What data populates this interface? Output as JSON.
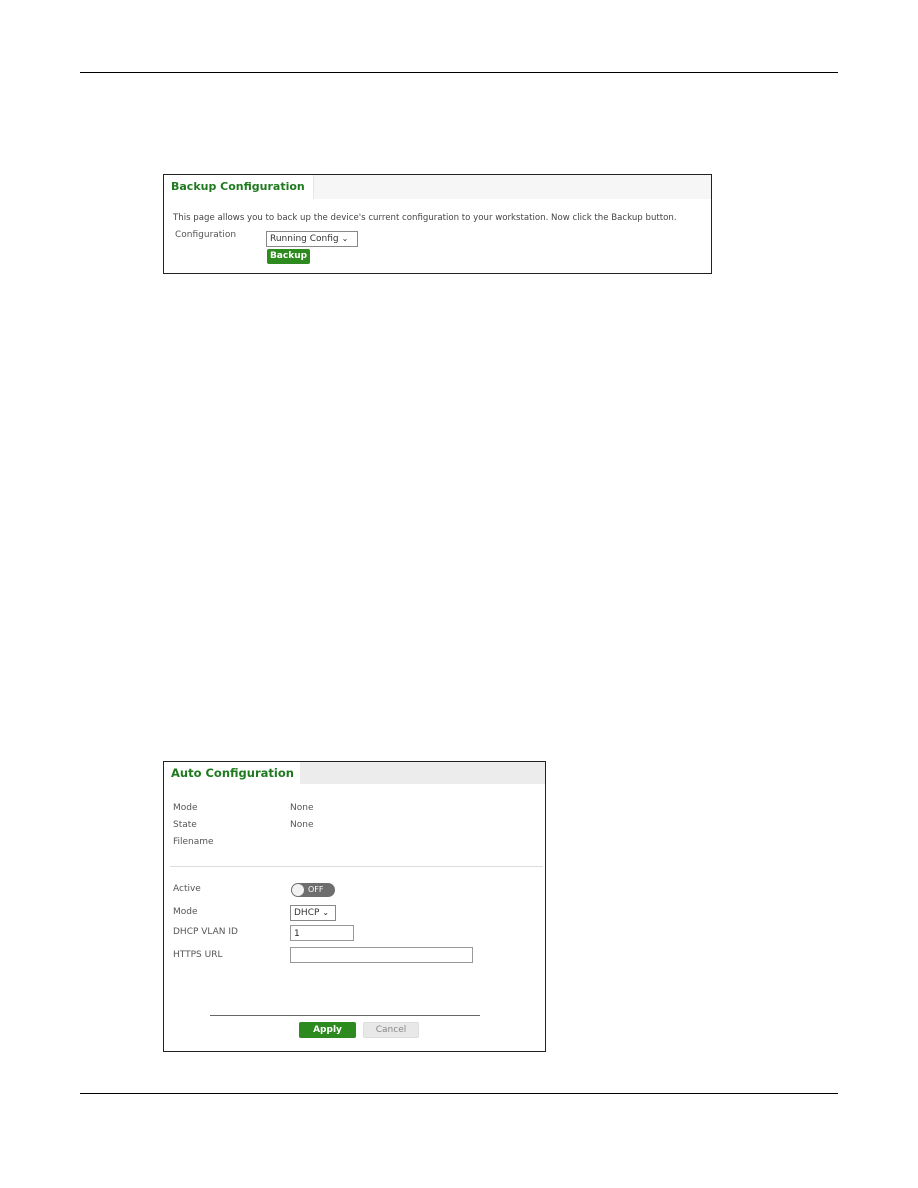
{
  "backup_panel": {
    "title": "Backup Configuration",
    "description": "This page allows you to back up the device's current configuration to your workstation. Now click the Backup button.",
    "configuration_label": "Configuration",
    "configuration_value": "Running Config",
    "backup_button": "Backup"
  },
  "auto_panel": {
    "title": "Auto Configuration",
    "status": {
      "mode_label": "Mode",
      "mode_value": "None",
      "state_label": "State",
      "state_value": "None",
      "filename_label": "Filename",
      "filename_value": ""
    },
    "form": {
      "active_label": "Active",
      "active_toggle": "OFF",
      "mode_label": "Mode",
      "mode_value": "DHCP",
      "dhcp_vlan_label": "DHCP VLAN ID",
      "dhcp_vlan_value": "1",
      "https_url_label": "HTTPS URL",
      "https_url_value": ""
    },
    "apply_button": "Apply",
    "cancel_button": "Cancel"
  },
  "colors": {
    "accent_green": "#2d8a1f",
    "title_green": "#1f7a1f"
  }
}
